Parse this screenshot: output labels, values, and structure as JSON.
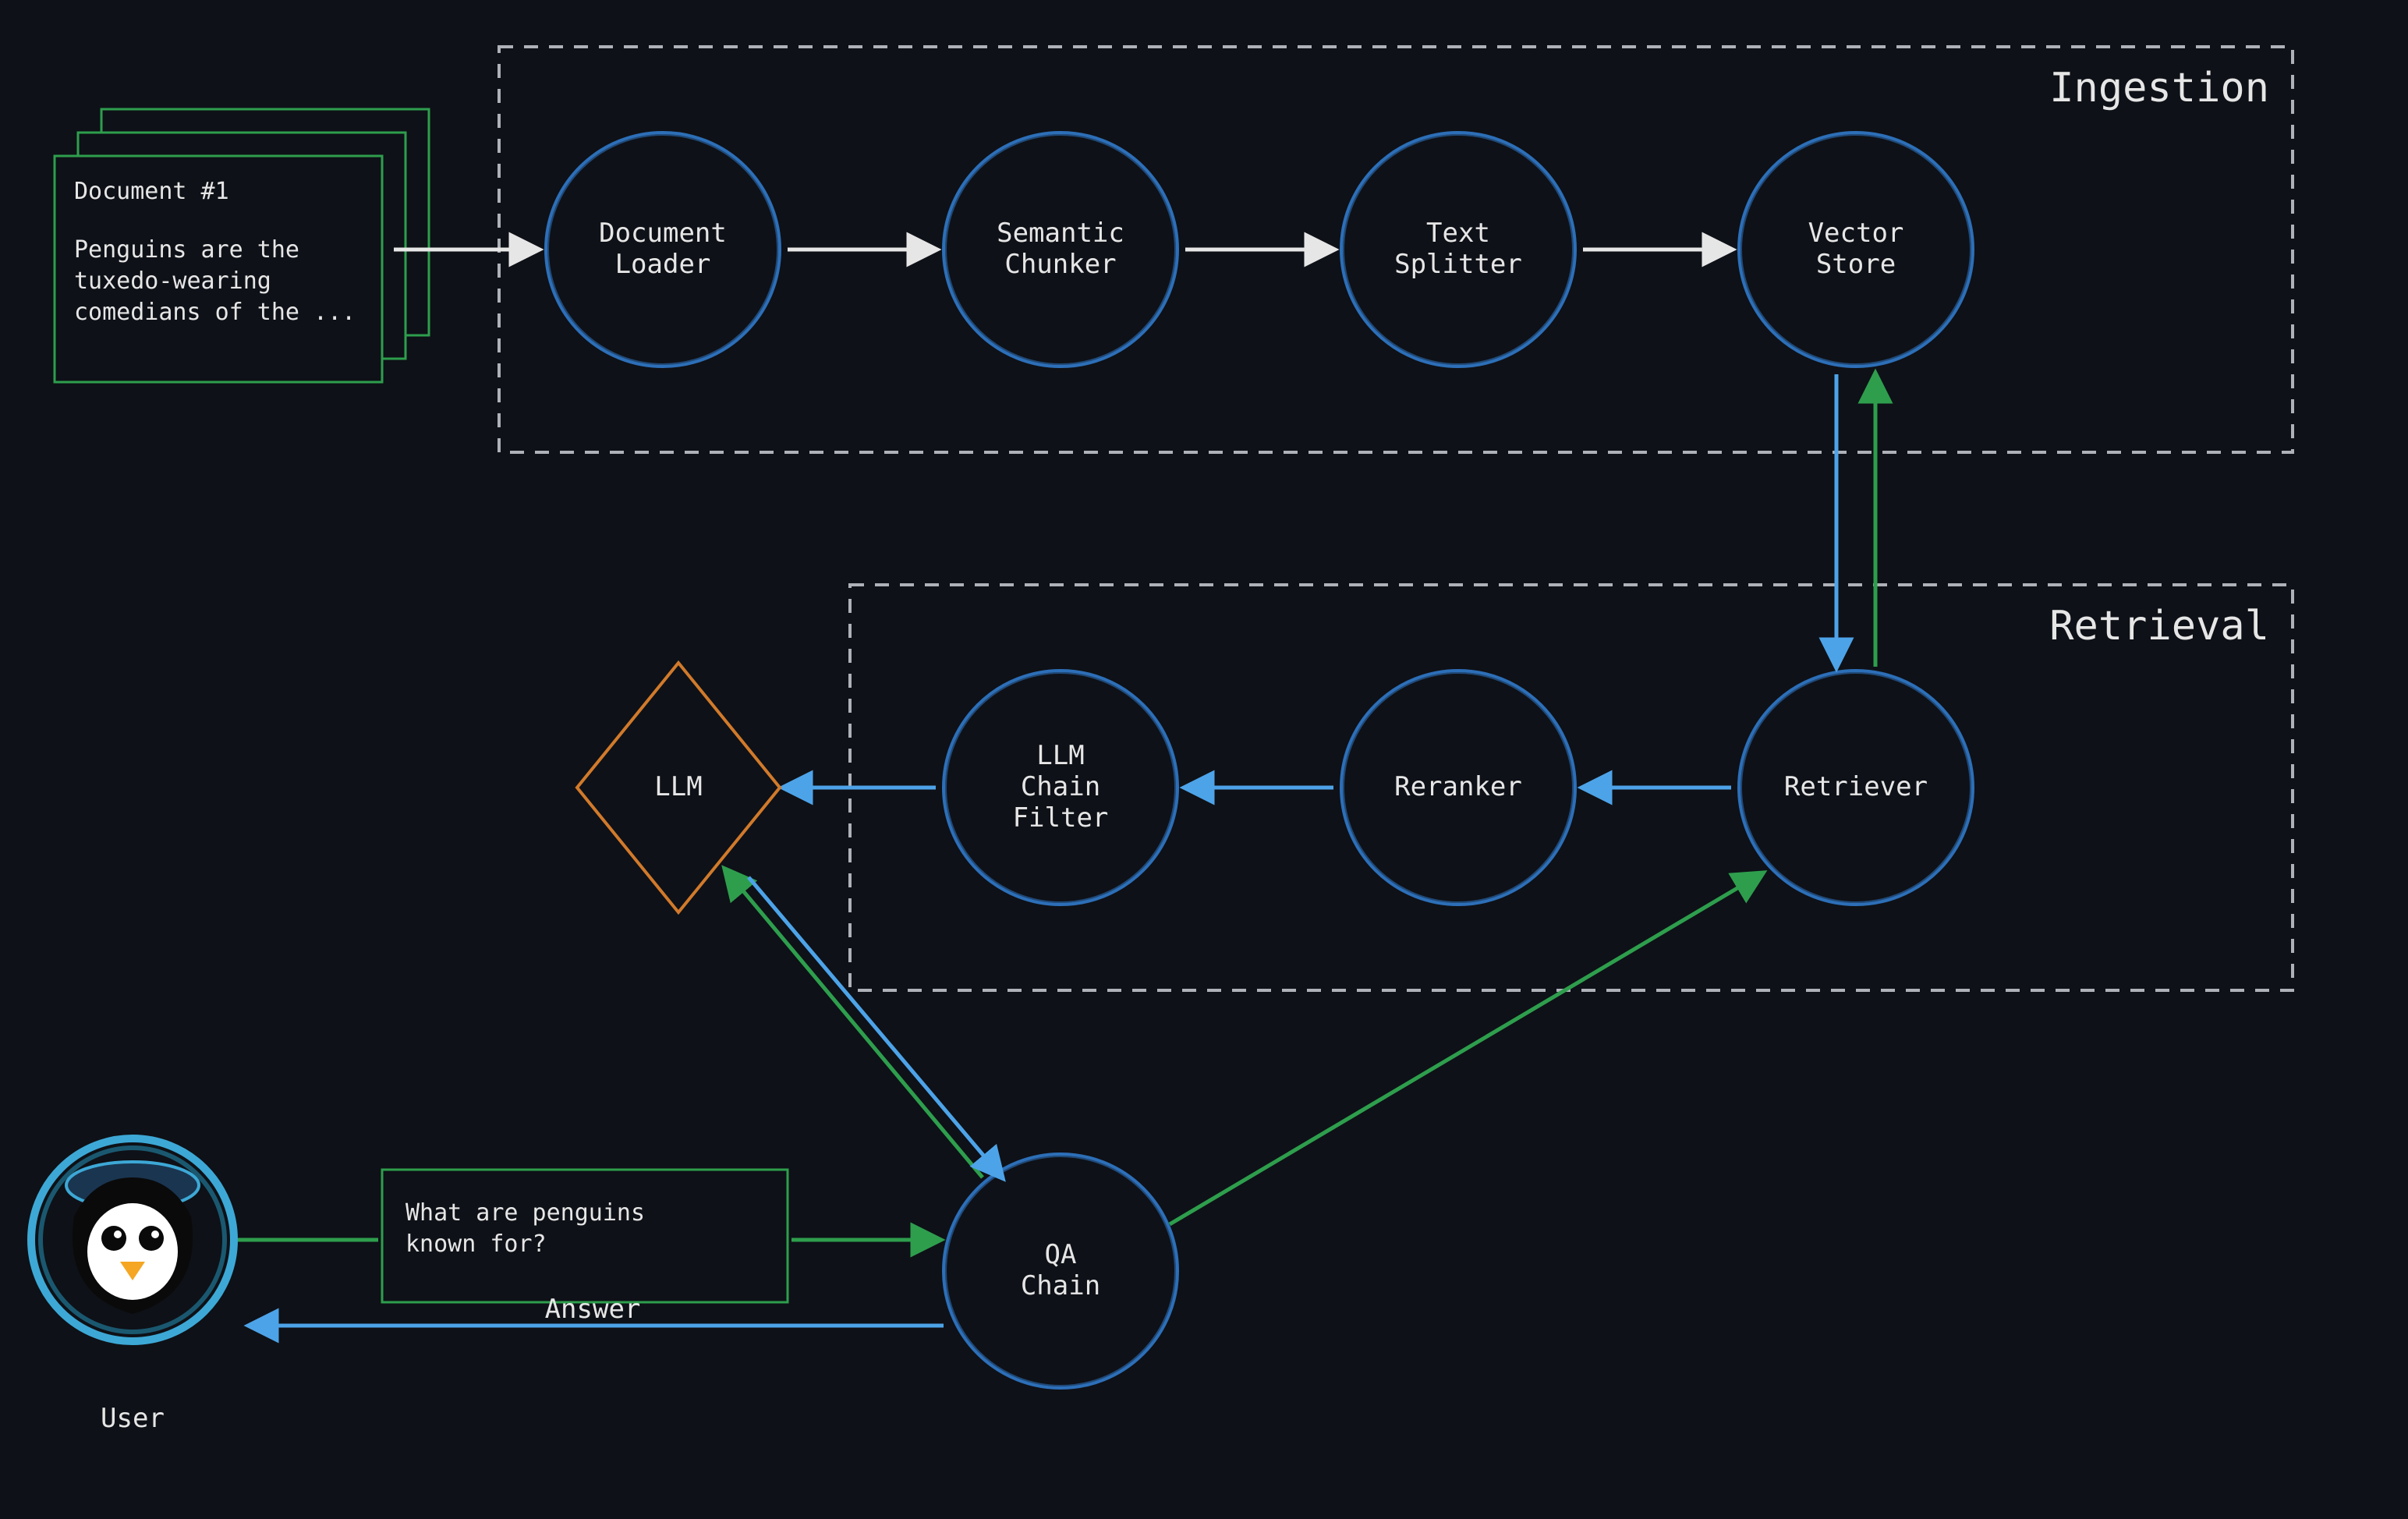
{
  "colors": {
    "background": "#0e1117",
    "white": "#e6e6e6",
    "blue": "#2d6fb8",
    "green": "#2e9e4d",
    "orange": "#d17a2b",
    "section_border": "#aeb2b8",
    "doc_border": "#2e9e4d"
  },
  "sections": {
    "ingestion": {
      "title": "Ingestion"
    },
    "retrieval": {
      "title": "Retrieval"
    }
  },
  "document": {
    "title": "Document #1",
    "body": "Penguins are the tuxedo-wearing comedians of the ..."
  },
  "nodes": {
    "document_loader": {
      "line1": "Document",
      "line2": "Loader"
    },
    "semantic_chunker": {
      "line1": "Semantic",
      "line2": "Chunker"
    },
    "text_splitter": {
      "line1": "Text",
      "line2": "Splitter"
    },
    "vector_store": {
      "line1": "Vector",
      "line2": "Store"
    },
    "retriever": {
      "line1": "Retriever"
    },
    "reranker": {
      "line1": "Reranker"
    },
    "llm_chain_filter": {
      "line1": "LLM",
      "line2": "Chain",
      "line3": "Filter"
    },
    "llm": {
      "line1": "LLM"
    },
    "qa_chain": {
      "line1": "QA",
      "line2": "Chain"
    }
  },
  "query": {
    "text": "What are penguins known for?"
  },
  "labels": {
    "user": "User",
    "answer": "Answer"
  }
}
